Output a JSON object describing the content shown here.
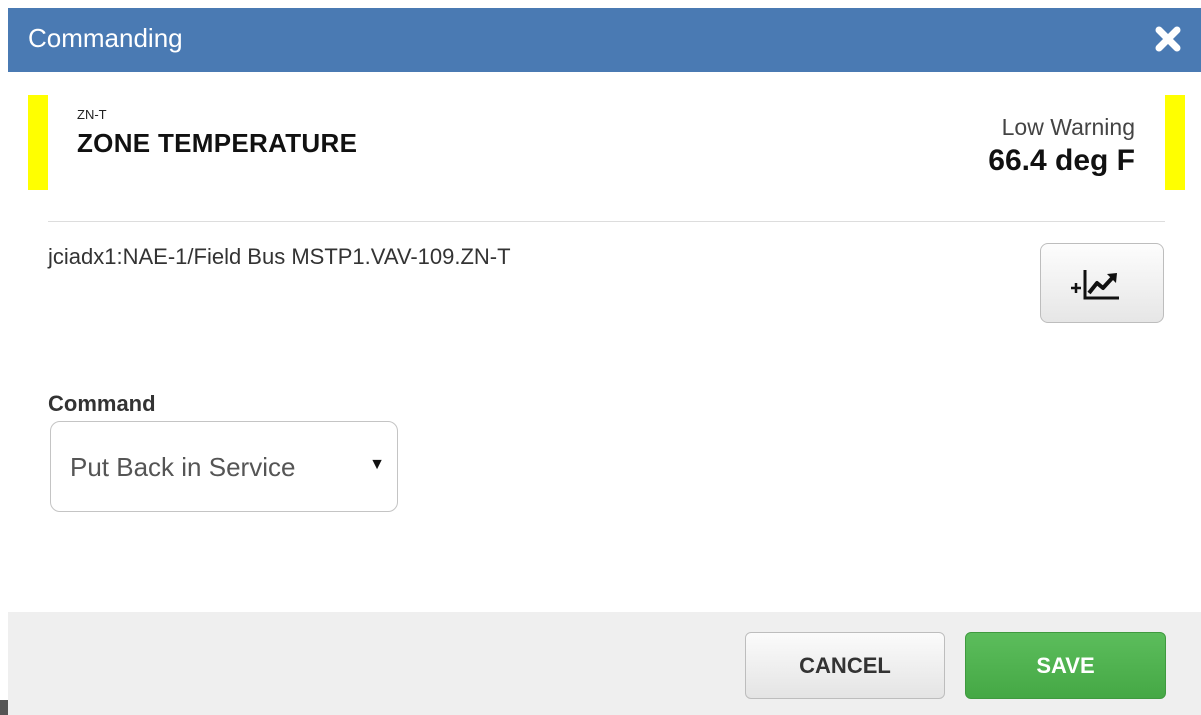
{
  "dialog": {
    "title": "Commanding",
    "close_icon": "close-icon"
  },
  "point": {
    "short_name": "ZN-T",
    "name": "ZONE TEMPERATURE",
    "status": "Low Warning",
    "value": "66.4 deg F",
    "status_color": "#ffff00",
    "object_path": "jciadx1:NAE-1/Field Bus MSTP1.VAV-109.ZN-T"
  },
  "trend": {
    "icon": "add-trend-icon"
  },
  "command": {
    "label": "Command",
    "selected": "Put Back in Service"
  },
  "footer": {
    "cancel_label": "CANCEL",
    "save_label": "SAVE"
  },
  "colors": {
    "titlebar": "#4a7ab3",
    "save": "#4cae4c",
    "footer": "#efefef"
  }
}
